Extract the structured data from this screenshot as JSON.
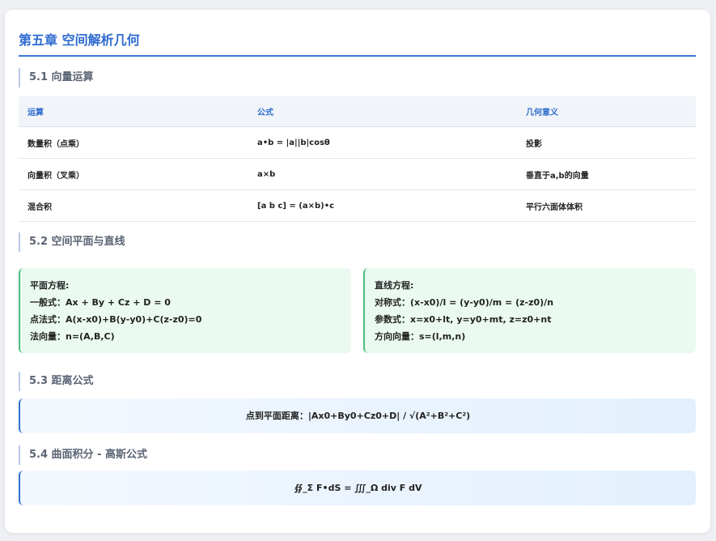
{
  "chapter_title": "第五章 空间解析几何",
  "sections": {
    "s1": {
      "title": "5.1 向量运算",
      "headers": [
        "运算",
        "公式",
        "几何意义"
      ],
      "rows": [
        [
          "数量积（点乘）",
          "a•b = |a||b|cosθ",
          "投影"
        ],
        [
          "向量积（叉乘）",
          "a×b",
          "垂直于a,b的向量"
        ],
        [
          "混合积",
          "[a b c] = (a×b)•c",
          "平行六面体体积"
        ]
      ]
    },
    "s2": {
      "title": "5.2 空间平面与直线",
      "plane": {
        "heading": "平面方程:",
        "lines": [
          "一般式：Ax + By + Cz + D = 0",
          "点法式：A(x-x0)+B(y-y0)+C(z-z0)=0",
          "法向量：n=(A,B,C)"
        ]
      },
      "line": {
        "heading": "直线方程:",
        "lines": [
          "对称式：(x-x0)/l = (y-y0)/m = (z-z0)/n",
          "参数式：x=x0+lt, y=y0+mt, z=z0+nt",
          "方向向量：s=(l,m,n)"
        ]
      }
    },
    "s3": {
      "title": "5.3 距离公式",
      "formula": "点到平面距离：|Ax0+By0+Cz0+D| / √(A²+B²+C²)"
    },
    "s4": {
      "title": "5.4 曲面积分 - 高斯公式",
      "formula": "∯_Σ F•dS = ∭_Ω div F dV"
    }
  }
}
